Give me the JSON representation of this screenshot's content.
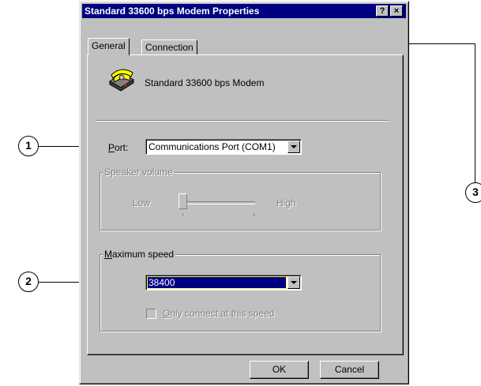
{
  "window": {
    "title": "Standard 33600 bps Modem Properties",
    "help_button": "?",
    "close_button": "×"
  },
  "tabs": [
    {
      "label": "General",
      "active": true
    },
    {
      "label": "Connection",
      "active": false
    }
  ],
  "device": {
    "icon": "telephone-modem-icon",
    "name": "Standard 33600 bps Modem"
  },
  "port": {
    "label": "Port:",
    "value": "Communications Port (COM1)"
  },
  "speaker": {
    "group_label": "Speaker volume",
    "low_label": "Low",
    "high_label": "High",
    "level": 0.0,
    "enabled": false
  },
  "max_speed": {
    "group_label": "Maximum speed",
    "value": "38400",
    "only_connect_label": "Only connect at this speed",
    "only_connect_checked": false,
    "only_connect_enabled": false
  },
  "buttons": {
    "ok": "OK",
    "cancel": "Cancel"
  },
  "callouts": [
    "1",
    "2",
    "3"
  ],
  "colors": {
    "titlebar": "#000080",
    "selection": "#000080",
    "face": "#c0c0c0"
  }
}
